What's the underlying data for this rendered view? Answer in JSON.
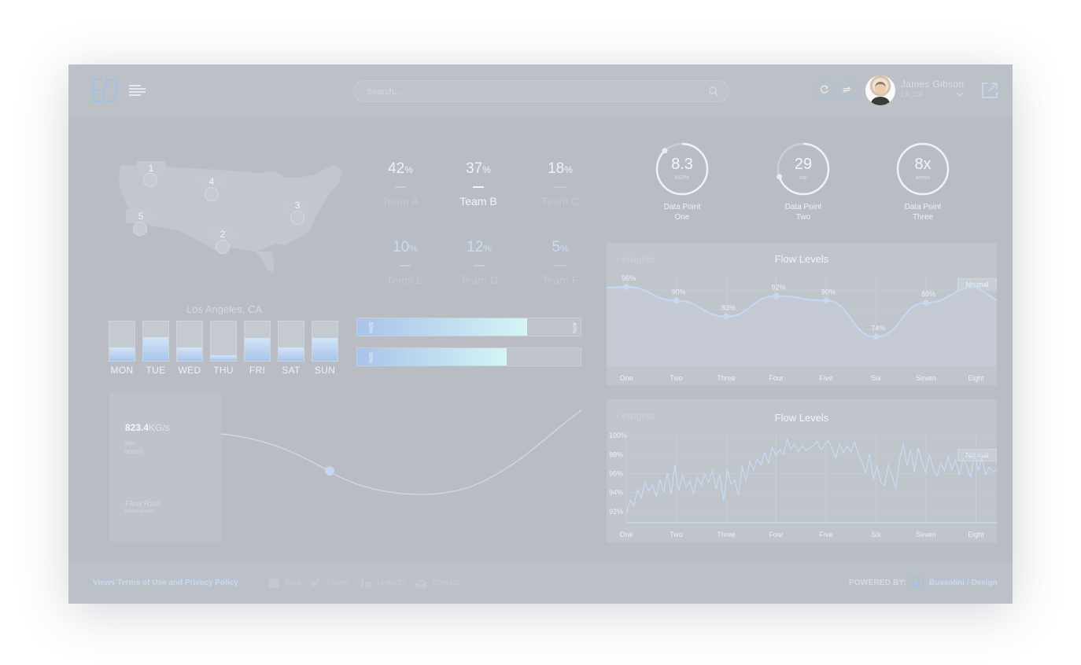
{
  "header": {
    "search_placeholder": "Search...",
    "user_name": "James Gibson",
    "user_location": "LA, CA"
  },
  "map": {
    "pins": [
      "1",
      "4",
      "5",
      "3",
      "2"
    ],
    "location_title": "Los Angeles, CA"
  },
  "days": [
    {
      "label": "MON",
      "level": 0.35
    },
    {
      "label": "TUE",
      "level": 0.6
    },
    {
      "label": "WED",
      "level": 0.35
    },
    {
      "label": "THU",
      "level": 0.15
    },
    {
      "label": "FRI",
      "level": 0.58
    },
    {
      "label": "SAT",
      "level": 0.35
    },
    {
      "label": "SUN",
      "level": 0.58
    }
  ],
  "teams": [
    {
      "value": "42",
      "unit": "%",
      "name": "Team A"
    },
    {
      "value": "37",
      "unit": "%",
      "name": "Team B"
    },
    {
      "value": "18",
      "unit": "%",
      "name": "Team C"
    },
    {
      "value": "10",
      "unit": "%",
      "name": "Team E"
    },
    {
      "value": "12",
      "unit": "%",
      "name": "Team D"
    },
    {
      "value": "5",
      "unit": "%",
      "name": "Team F"
    }
  ],
  "progress_bars": [
    {
      "label_left": "50%",
      "label_right": "40%",
      "fill": 0.76
    },
    {
      "label_left": "50%",
      "label_right": "",
      "fill": 0.67
    }
  ],
  "flow_rate": {
    "value": "823.4",
    "unit": "KG/s",
    "sub_line1": "Max",
    "sub_line2": "00/00/0",
    "name": "Flow Rate",
    "site": "bussolini.com"
  },
  "gauges": [
    {
      "value": "8.3",
      "unit": "KG/hr",
      "label_line1": "Data Point",
      "label_line2": "One",
      "fill": 0.88
    },
    {
      "value": "29",
      "unit": "min",
      "label_line1": "Data Point",
      "label_line2": "Two",
      "fill": 0.7
    },
    {
      "value": "8x",
      "unit": "worse",
      "label_line1": "Data Point",
      "label_line2": "Three",
      "fill": 1.0
    }
  ],
  "panel1": {
    "back_label": "Insights",
    "title": "Flow Levels",
    "badge": "Normal"
  },
  "panel2": {
    "back_label": "Insights",
    "title": "Flow Levels",
    "badge": "Normal"
  },
  "chart_data": [
    {
      "type": "area",
      "title": "Flow Levels",
      "categories": [
        "One",
        "Two",
        "Three",
        "Four",
        "Five",
        "Six",
        "Seven",
        "Eight"
      ],
      "values": [
        96,
        90,
        83,
        92,
        90,
        74,
        89,
        96
      ],
      "value_labels": [
        "96%",
        "90%",
        "83%",
        "92%",
        "90%",
        "74%",
        "89%",
        ""
      ],
      "ylim": [
        60,
        105
      ],
      "grid": true
    },
    {
      "type": "line",
      "title": "Flow Levels",
      "categories": [
        "One",
        "Two",
        "Three",
        "Four",
        "Five",
        "Six",
        "Seven",
        "Eight"
      ],
      "y_ticks": [
        "100%",
        "98%",
        "96%",
        "94%",
        "92%"
      ],
      "ylim": [
        91,
        100.5
      ],
      "values": [
        91.8,
        93.2,
        92.6,
        94.3,
        93.4,
        95.1,
        94.2,
        94.8,
        93.6,
        95.4,
        94.0,
        96.1,
        93.8,
        96.9,
        94.2,
        95.8,
        94.6,
        95.2,
        93.9,
        95.6,
        94.8,
        96.0,
        95.1,
        96.3,
        94.4,
        95.9,
        93.1,
        96.4,
        94.9,
        95.3,
        93.7,
        96.8,
        95.2,
        97.3,
        96.4,
        97.5,
        96.9,
        98.2,
        97.1,
        98.8,
        97.9,
        98.5,
        98.0,
        99.6,
        98.6,
        99.1,
        98.3,
        98.9,
        98.4,
        98.7,
        98.9,
        99.4,
        98.5,
        99.0,
        99.5,
        98.6,
        97.7,
        99.1,
        98.2,
        98.9,
        98.3,
        99.3,
        98.1,
        97.2,
        96.0,
        98.1,
        95.4,
        96.8,
        95.1,
        94.7,
        96.9,
        95.8,
        94.4,
        97.4,
        99.2,
        96.8,
        98.5,
        96.2,
        98.7,
        97.3,
        96.1,
        98.0,
        96.5,
        95.7,
        97.1,
        96.3,
        97.8,
        96.4,
        97.4,
        95.9,
        97.6,
        96.8,
        95.6,
        98.2,
        96.3,
        97.7,
        95.9,
        96.7,
        96.2,
        96.4
      ]
    }
  ],
  "footer": {
    "legal": "Views Terms of Use and Privacy Policy",
    "links": [
      "Blog",
      "Twitter",
      "LinkedIn",
      "Contact"
    ],
    "powered_by": "POWERED BY:",
    "brand": "Bussolini / Design"
  }
}
